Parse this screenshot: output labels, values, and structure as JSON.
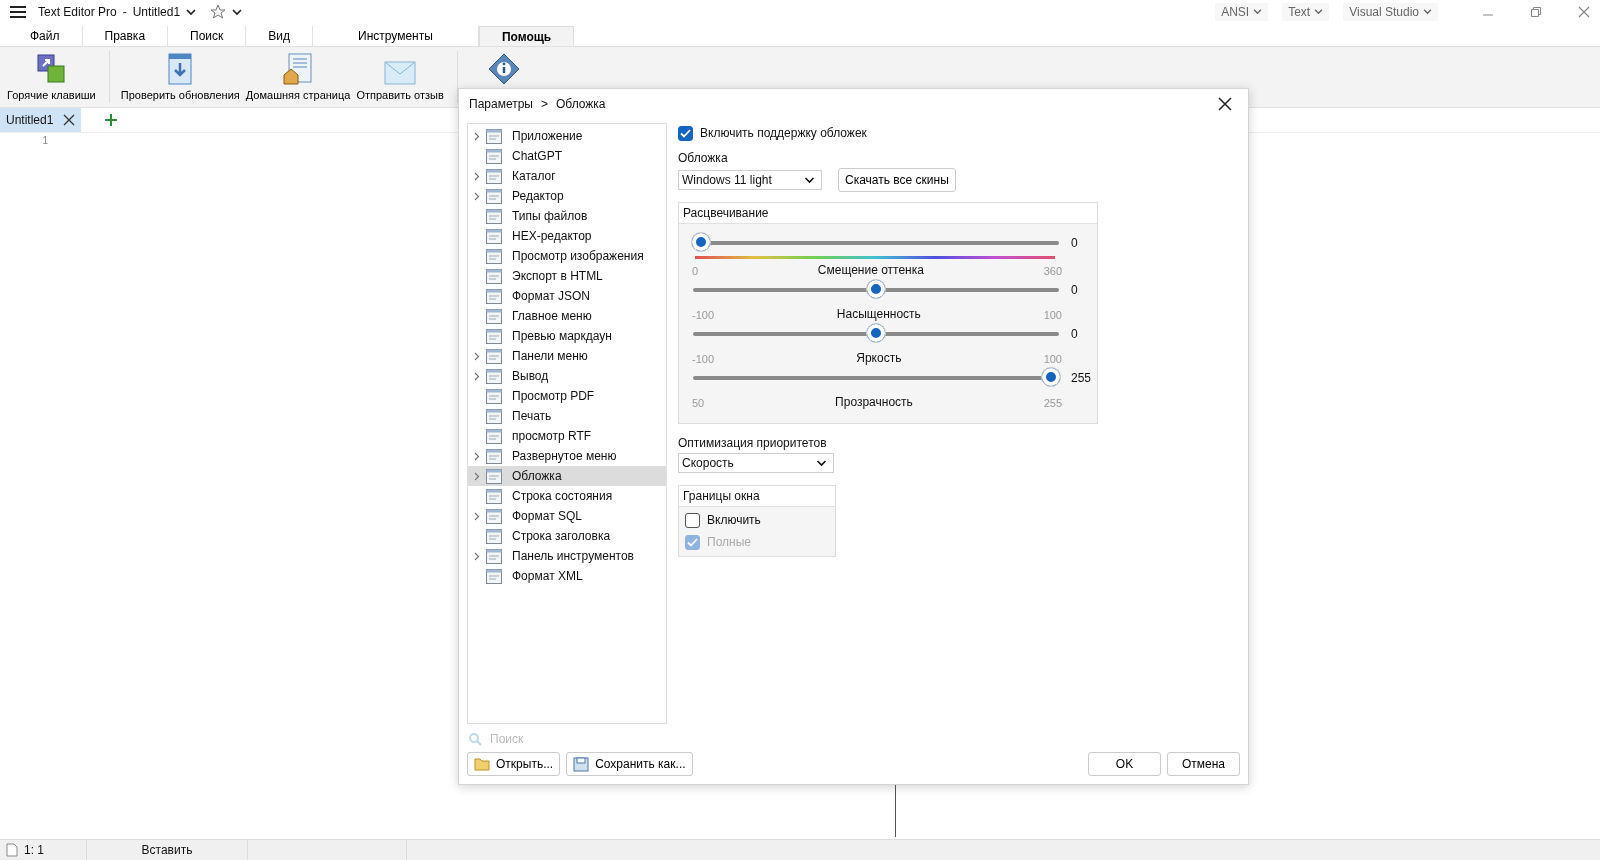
{
  "title_bar": {
    "app": "Text Editor Pro",
    "separator": "-",
    "document": "Untitled1",
    "dropdowns": [
      "ANSI",
      "Text",
      "Visual Studio"
    ]
  },
  "menu_tabs": [
    {
      "label": "Файл",
      "selected": false
    },
    {
      "label": "Правка",
      "selected": false
    },
    {
      "label": "Поиск",
      "selected": false
    },
    {
      "label": "Вид",
      "selected": false
    },
    {
      "label": "Инструменты",
      "selected": false
    },
    {
      "label": "Помощь",
      "selected": true
    }
  ],
  "ribbon": [
    {
      "label": "Горячие клавиши"
    },
    {
      "label": "Проверить обновления"
    },
    {
      "label": "Домашняя страница"
    },
    {
      "label": "Отправить отзыв"
    }
  ],
  "doc_tabs": [
    {
      "label": "Untitled1",
      "selected": true
    }
  ],
  "editor": {
    "line_numbers": [
      "1"
    ]
  },
  "dialog": {
    "breadcrumb": [
      "Параметры",
      "Обложка"
    ],
    "breadcrumb_separator": ">",
    "tree": [
      {
        "label": "Приложение",
        "expandable": true,
        "selected": false
      },
      {
        "label": "ChatGPT",
        "expandable": false,
        "selected": false
      },
      {
        "label": "Каталог",
        "expandable": true,
        "selected": false
      },
      {
        "label": "Редактор",
        "expandable": true,
        "selected": false
      },
      {
        "label": "Типы файлов",
        "expandable": false,
        "selected": false
      },
      {
        "label": "HEX-редактор",
        "expandable": false,
        "selected": false
      },
      {
        "label": "Просмотр изображения",
        "expandable": false,
        "selected": false
      },
      {
        "label": "Экспорт в HTML",
        "expandable": false,
        "selected": false
      },
      {
        "label": "Формат JSON",
        "expandable": false,
        "selected": false
      },
      {
        "label": "Главное меню",
        "expandable": false,
        "selected": false
      },
      {
        "label": "Превью маркдаун",
        "expandable": false,
        "selected": false
      },
      {
        "label": "Панели меню",
        "expandable": true,
        "selected": false
      },
      {
        "label": "Вывод",
        "expandable": true,
        "selected": false
      },
      {
        "label": "Просмотр PDF",
        "expandable": false,
        "selected": false
      },
      {
        "label": "Печать",
        "expandable": false,
        "selected": false
      },
      {
        "label": "просмотр RTF",
        "expandable": false,
        "selected": false
      },
      {
        "label": "Развернутое меню",
        "expandable": true,
        "selected": false
      },
      {
        "label": "Обложка",
        "expandable": true,
        "selected": true
      },
      {
        "label": "Строка состояния",
        "expandable": false,
        "selected": false
      },
      {
        "label": "Формат SQL",
        "expandable": true,
        "selected": false
      },
      {
        "label": "Строка заголовка",
        "expandable": false,
        "selected": false
      },
      {
        "label": "Панель инструментов",
        "expandable": true,
        "selected": false
      },
      {
        "label": "Формат XML",
        "expandable": false,
        "selected": false
      }
    ],
    "enable_skins": {
      "label": "Включить поддержку обложек",
      "checked": true
    },
    "skin": {
      "label": "Обложка",
      "value": "Windows 11 light",
      "button": "Скачать все скины"
    },
    "colorize": {
      "title": "Расцвечивание",
      "sliders": [
        {
          "kind": "hue",
          "reading": "0",
          "level": 0,
          "min": "0",
          "max": "360",
          "caption": "Смещение оттенка"
        },
        {
          "kind": "plain",
          "reading": "0",
          "level": 0.5,
          "min": "-100",
          "max": "100",
          "caption": "Насыщенность"
        },
        {
          "kind": "plain",
          "reading": "0",
          "level": 0.5,
          "min": "-100",
          "max": "100",
          "caption": "Яркость"
        },
        {
          "kind": "plain",
          "reading": "255",
          "level": 1,
          "min": "50",
          "max": "255",
          "caption": "Прозрачность"
        }
      ]
    },
    "priority": {
      "label": "Оптимизация приоритетов",
      "value": "Скорость"
    },
    "borders": {
      "title": "Границы окна",
      "options": [
        {
          "label": "Включить",
          "checked": false,
          "disabled": false
        },
        {
          "label": "Полные",
          "checked": true,
          "disabled": true
        }
      ]
    },
    "search": {
      "placeholder": "Поиск"
    },
    "left_buttons": [
      "Открыть...",
      "Сохранить как..."
    ],
    "right_buttons": [
      "OK",
      "Отмена"
    ]
  },
  "status_bar": {
    "position": "1: 1",
    "mode": "Вставить"
  }
}
